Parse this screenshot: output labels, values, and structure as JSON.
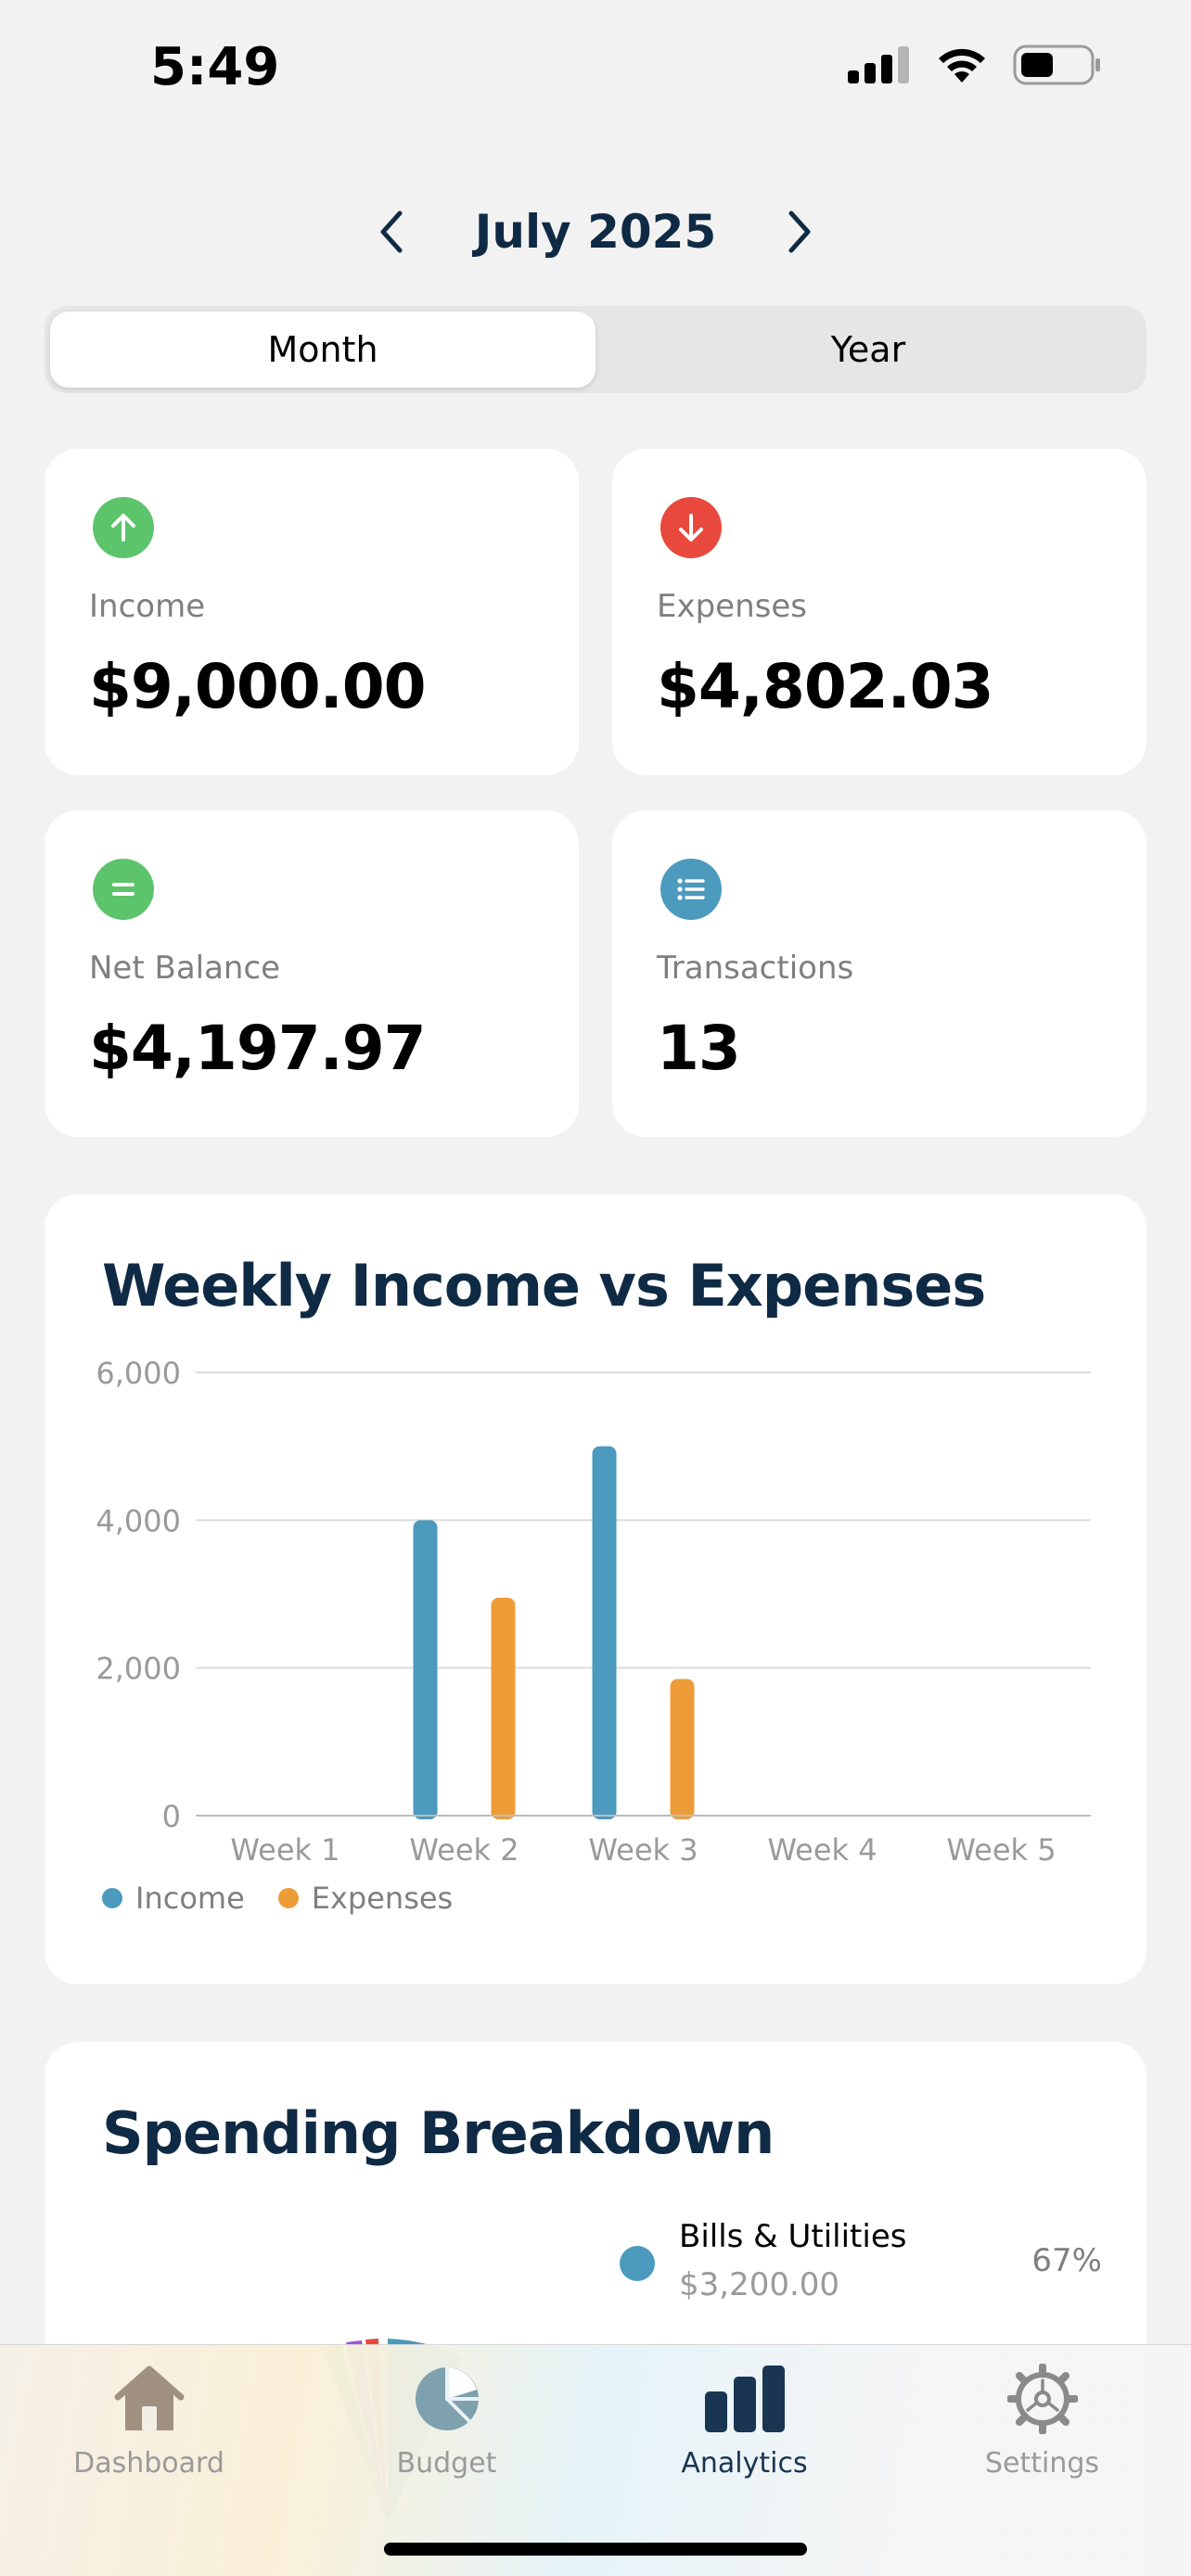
{
  "status_bar": {
    "time": "5:49"
  },
  "period": {
    "label": "July 2025"
  },
  "segments": [
    {
      "label": "Month",
      "active": true
    },
    {
      "label": "Year",
      "active": false
    }
  ],
  "stats": {
    "income": {
      "label": "Income",
      "value": "$9,000.00",
      "icon": "arrow-up-icon",
      "color": "#5cc46b"
    },
    "expenses": {
      "label": "Expenses",
      "value": "$4,802.03",
      "icon": "arrow-down-icon",
      "color": "#e9493d"
    },
    "net_balance": {
      "label": "Net Balance",
      "value": "$4,197.97",
      "icon": "equals-icon",
      "color": "#5cc46b"
    },
    "transactions": {
      "label": "Transactions",
      "value": "13",
      "icon": "list-icon",
      "color": "#4c9abd"
    }
  },
  "weekly_chart": {
    "title": "Weekly Income vs Expenses"
  },
  "chart_data": {
    "type": "bar",
    "title": "Weekly Income vs Expenses",
    "categories": [
      "Week 1",
      "Week 2",
      "Week 3",
      "Week 4",
      "Week 5"
    ],
    "series": [
      {
        "name": "Income",
        "color": "#4c9abd",
        "values": [
          0,
          4000,
          5000,
          0,
          0
        ]
      },
      {
        "name": "Expenses",
        "color": "#ee9c37",
        "values": [
          0,
          2950,
          1850,
          0,
          0
        ]
      }
    ],
    "ylim": [
      0,
      6000
    ],
    "yticks": [
      "0",
      "2,000",
      "4,000",
      "6,000"
    ],
    "grid": true,
    "legend_position": "bottom-left"
  },
  "breakdown": {
    "title": "Spending Breakdown",
    "items": [
      {
        "name": "Bills & Utilities",
        "amount": "$3,200.00",
        "percent": "67%",
        "color": "#4c9abd"
      }
    ]
  },
  "tabs": [
    {
      "label": "Dashboard",
      "icon": "house-icon",
      "active": false
    },
    {
      "label": "Budget",
      "icon": "pie-chart-icon",
      "active": false
    },
    {
      "label": "Analytics",
      "icon": "bar-chart-icon",
      "active": true
    },
    {
      "label": "Settings",
      "icon": "gear-icon",
      "active": false
    }
  ]
}
